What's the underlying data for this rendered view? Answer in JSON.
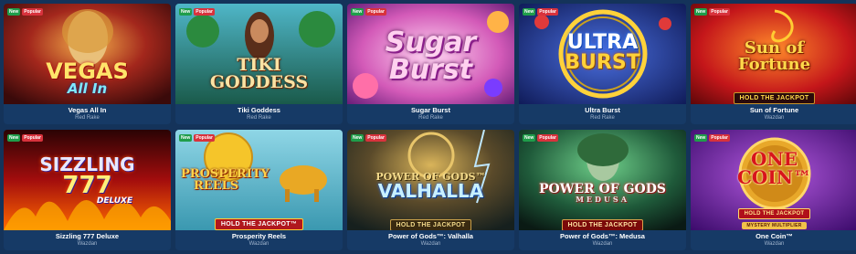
{
  "badges": {
    "new": "New",
    "popular": "Popular"
  },
  "games": [
    {
      "title": "Vegas All In",
      "provider": "Red Rake",
      "logo_line1": "VEGAS",
      "logo_line2": "All In"
    },
    {
      "title": "Tiki Goddess",
      "provider": "Red Rake",
      "logo_line1": "TIKI",
      "logo_line2": "GODDESS"
    },
    {
      "title": "Sugar Burst",
      "provider": "Red Rake",
      "logo_line1": "Sugar",
      "logo_line2": "Burst"
    },
    {
      "title": "Ultra Burst",
      "provider": "Red Rake",
      "logo_line1": "ULTRA",
      "logo_line2": "BURST"
    },
    {
      "title": "Sun of Fortune",
      "provider": "Wazdan",
      "logo_line1": "Sun of",
      "logo_line2": "Fortune",
      "sub": "HOLD THE JACKPOT"
    },
    {
      "title": "Sizzling 777 Deluxe",
      "provider": "Wazdan",
      "logo_line1": "SIZZLING",
      "logo_line2": "777",
      "logo_line3": "DELUXE"
    },
    {
      "title": "Prosperity Reels",
      "provider": "Wazdan",
      "logo_line1": "PROSPERITY",
      "logo_line2": "REELS",
      "sub": "HOLD THE JACKPOT™"
    },
    {
      "title": "Power of Gods™: Valhalla",
      "provider": "Wazdan",
      "logo_line1": "POWER OF GODS™",
      "logo_line2": "VALHALLA",
      "sub": "HOLD THE JACKPOT"
    },
    {
      "title": "Power of Gods™: Medusa",
      "provider": "Wazdan",
      "logo_line1": "POWER OF GODS",
      "logo_line2": "MEDUSA",
      "sub": "HOLD THE JACKPOT"
    },
    {
      "title": "One Coin™",
      "provider": "Wazdan",
      "logo_line1": "ONE",
      "logo_line2": "COIN™",
      "sub": "HOLD THE JACKPOT",
      "sub2": "MYSTERY MULTIPLIER"
    }
  ],
  "colors": {
    "page_bg": "#14335a",
    "badge_new": "#1f9d4a",
    "badge_popular": "#d8323c",
    "provider_text": "#9fb3cc"
  }
}
